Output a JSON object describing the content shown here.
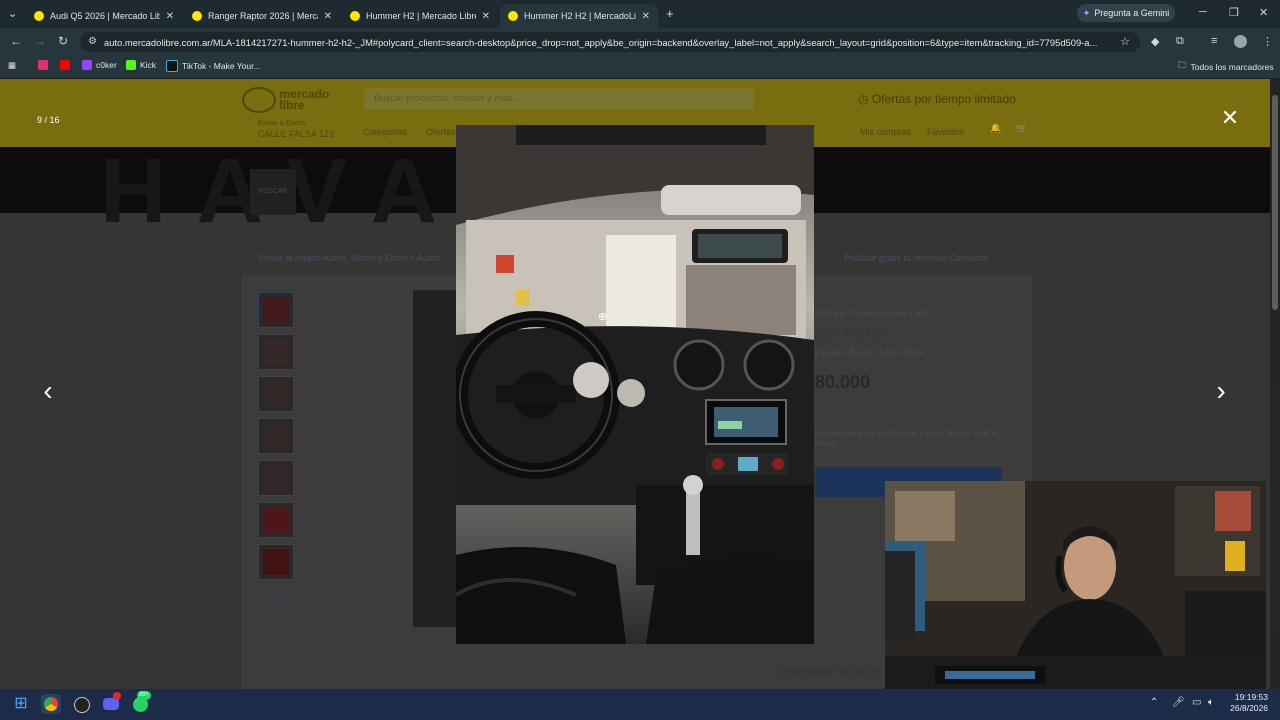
{
  "browser": {
    "tabs": [
      {
        "title": "Audi Q5 2026 | Mercado Libre Argentina",
        "active": false
      },
      {
        "title": "Ranger Raptor 2026 | Mercado Libre",
        "active": false
      },
      {
        "title": "Hummer H2 | Mercado Libre 🇦🇷",
        "active": false
      },
      {
        "title": "Hummer H2 H2 | MercadoLibre",
        "active": true
      }
    ],
    "gemini_label": "Pregunta a Gemini",
    "url": "auto.mercadolibre.com.ar/MLA-1814217271-hummer-h2-h2-_JM#polycard_client=search-desktop&price_drop=not_apply&be_origin=backend&overlay_label=not_apply&search_layout=grid&position=6&type=item&tracking_id=7795d509-a...",
    "bookmarks": [
      {
        "label": "",
        "icon": "instagram-icon",
        "color": "#e1306c"
      },
      {
        "label": "",
        "icon": "youtube-icon",
        "color": "#ff0000"
      },
      {
        "label": "c0ker",
        "icon": "twitch-icon",
        "color": "#9146ff"
      },
      {
        "label": "Kick",
        "icon": "kick-icon",
        "color": "#53fc18"
      },
      {
        "label": "TikTok - Make Your...",
        "icon": "tiktok-icon",
        "color": "#111111"
      }
    ],
    "all_bookmarks_label": "Todos los marcadores"
  },
  "page": {
    "search_placeholder": "Buscar productos, marcas y más...",
    "promo": "Ofertas por tiempo limitado",
    "logo_text": "mercado libre",
    "address_label": "Enviar a Carlos",
    "address": "CALLE FALSA 123",
    "nav": [
      "Categorías",
      "Ofertas"
    ],
    "nav_right": [
      "Mis compras",
      "Favoritos"
    ],
    "crumbs_left": "Volver al listado   Autos, Motos y Otros > Autos",
    "crumbs_right": "Publicar gratis tu vehículo   Compartir",
    "meta": "·000 km · Publicado hace 1 año",
    "title_fragment": "mer H2 H2",
    "location_fragment": "e López, Bs.As. G.B.A. Norte",
    "price_fragment": "80.000",
    "vehicle_location": "te vehículo está en Vicente López, Bs.As. G.B.A. Norte",
    "store_info": "Información de la tie",
    "thumb_more": "9"
  },
  "lightbox": {
    "counter": "9 / 16",
    "close_icon": "close-icon",
    "prev_icon": "chevron-left-icon",
    "next_icon": "chevron-right-icon"
  },
  "taskbar": {
    "time": "19:19:53",
    "date": "26/8/2026",
    "badge_discord": "99+"
  }
}
